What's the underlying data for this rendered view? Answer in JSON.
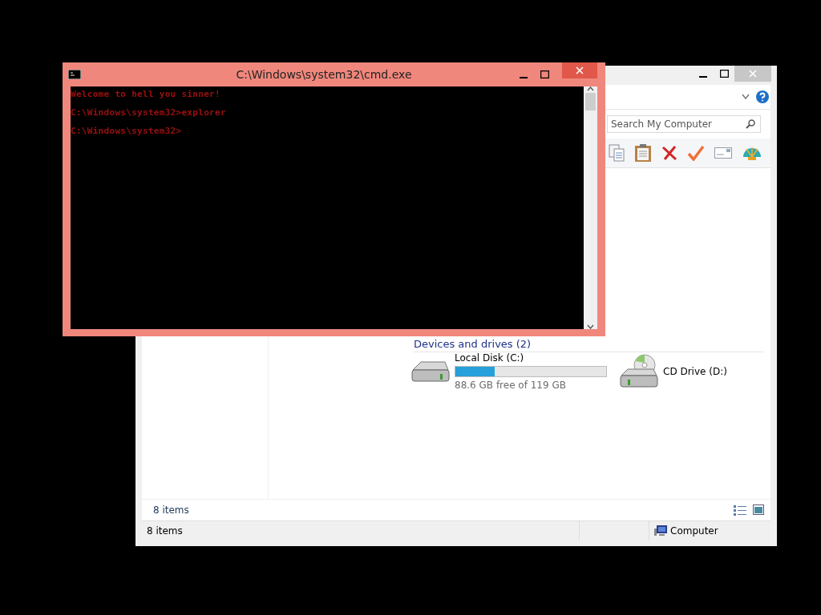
{
  "cmd": {
    "title": "C:\\Windows\\system32\\cmd.exe",
    "lines": [
      "Welcome to hell you sinner!",
      "C:\\Windows\\system32>explorer",
      "C:\\Windows\\system32>"
    ]
  },
  "explorer": {
    "search": {
      "placeholder": "Search My Computer"
    },
    "section_header": "Devices and drives (2)",
    "drives": [
      {
        "kind": "disk",
        "name": "Local Disk (C:)",
        "level": 0.26,
        "reading": "88.6 GB free of 119 GB"
      },
      {
        "kind": "cd",
        "name": "CD Drive (D:)"
      }
    ],
    "details_count": "8 items",
    "status_bar": {
      "count": "8 items",
      "location": "Computer"
    }
  }
}
